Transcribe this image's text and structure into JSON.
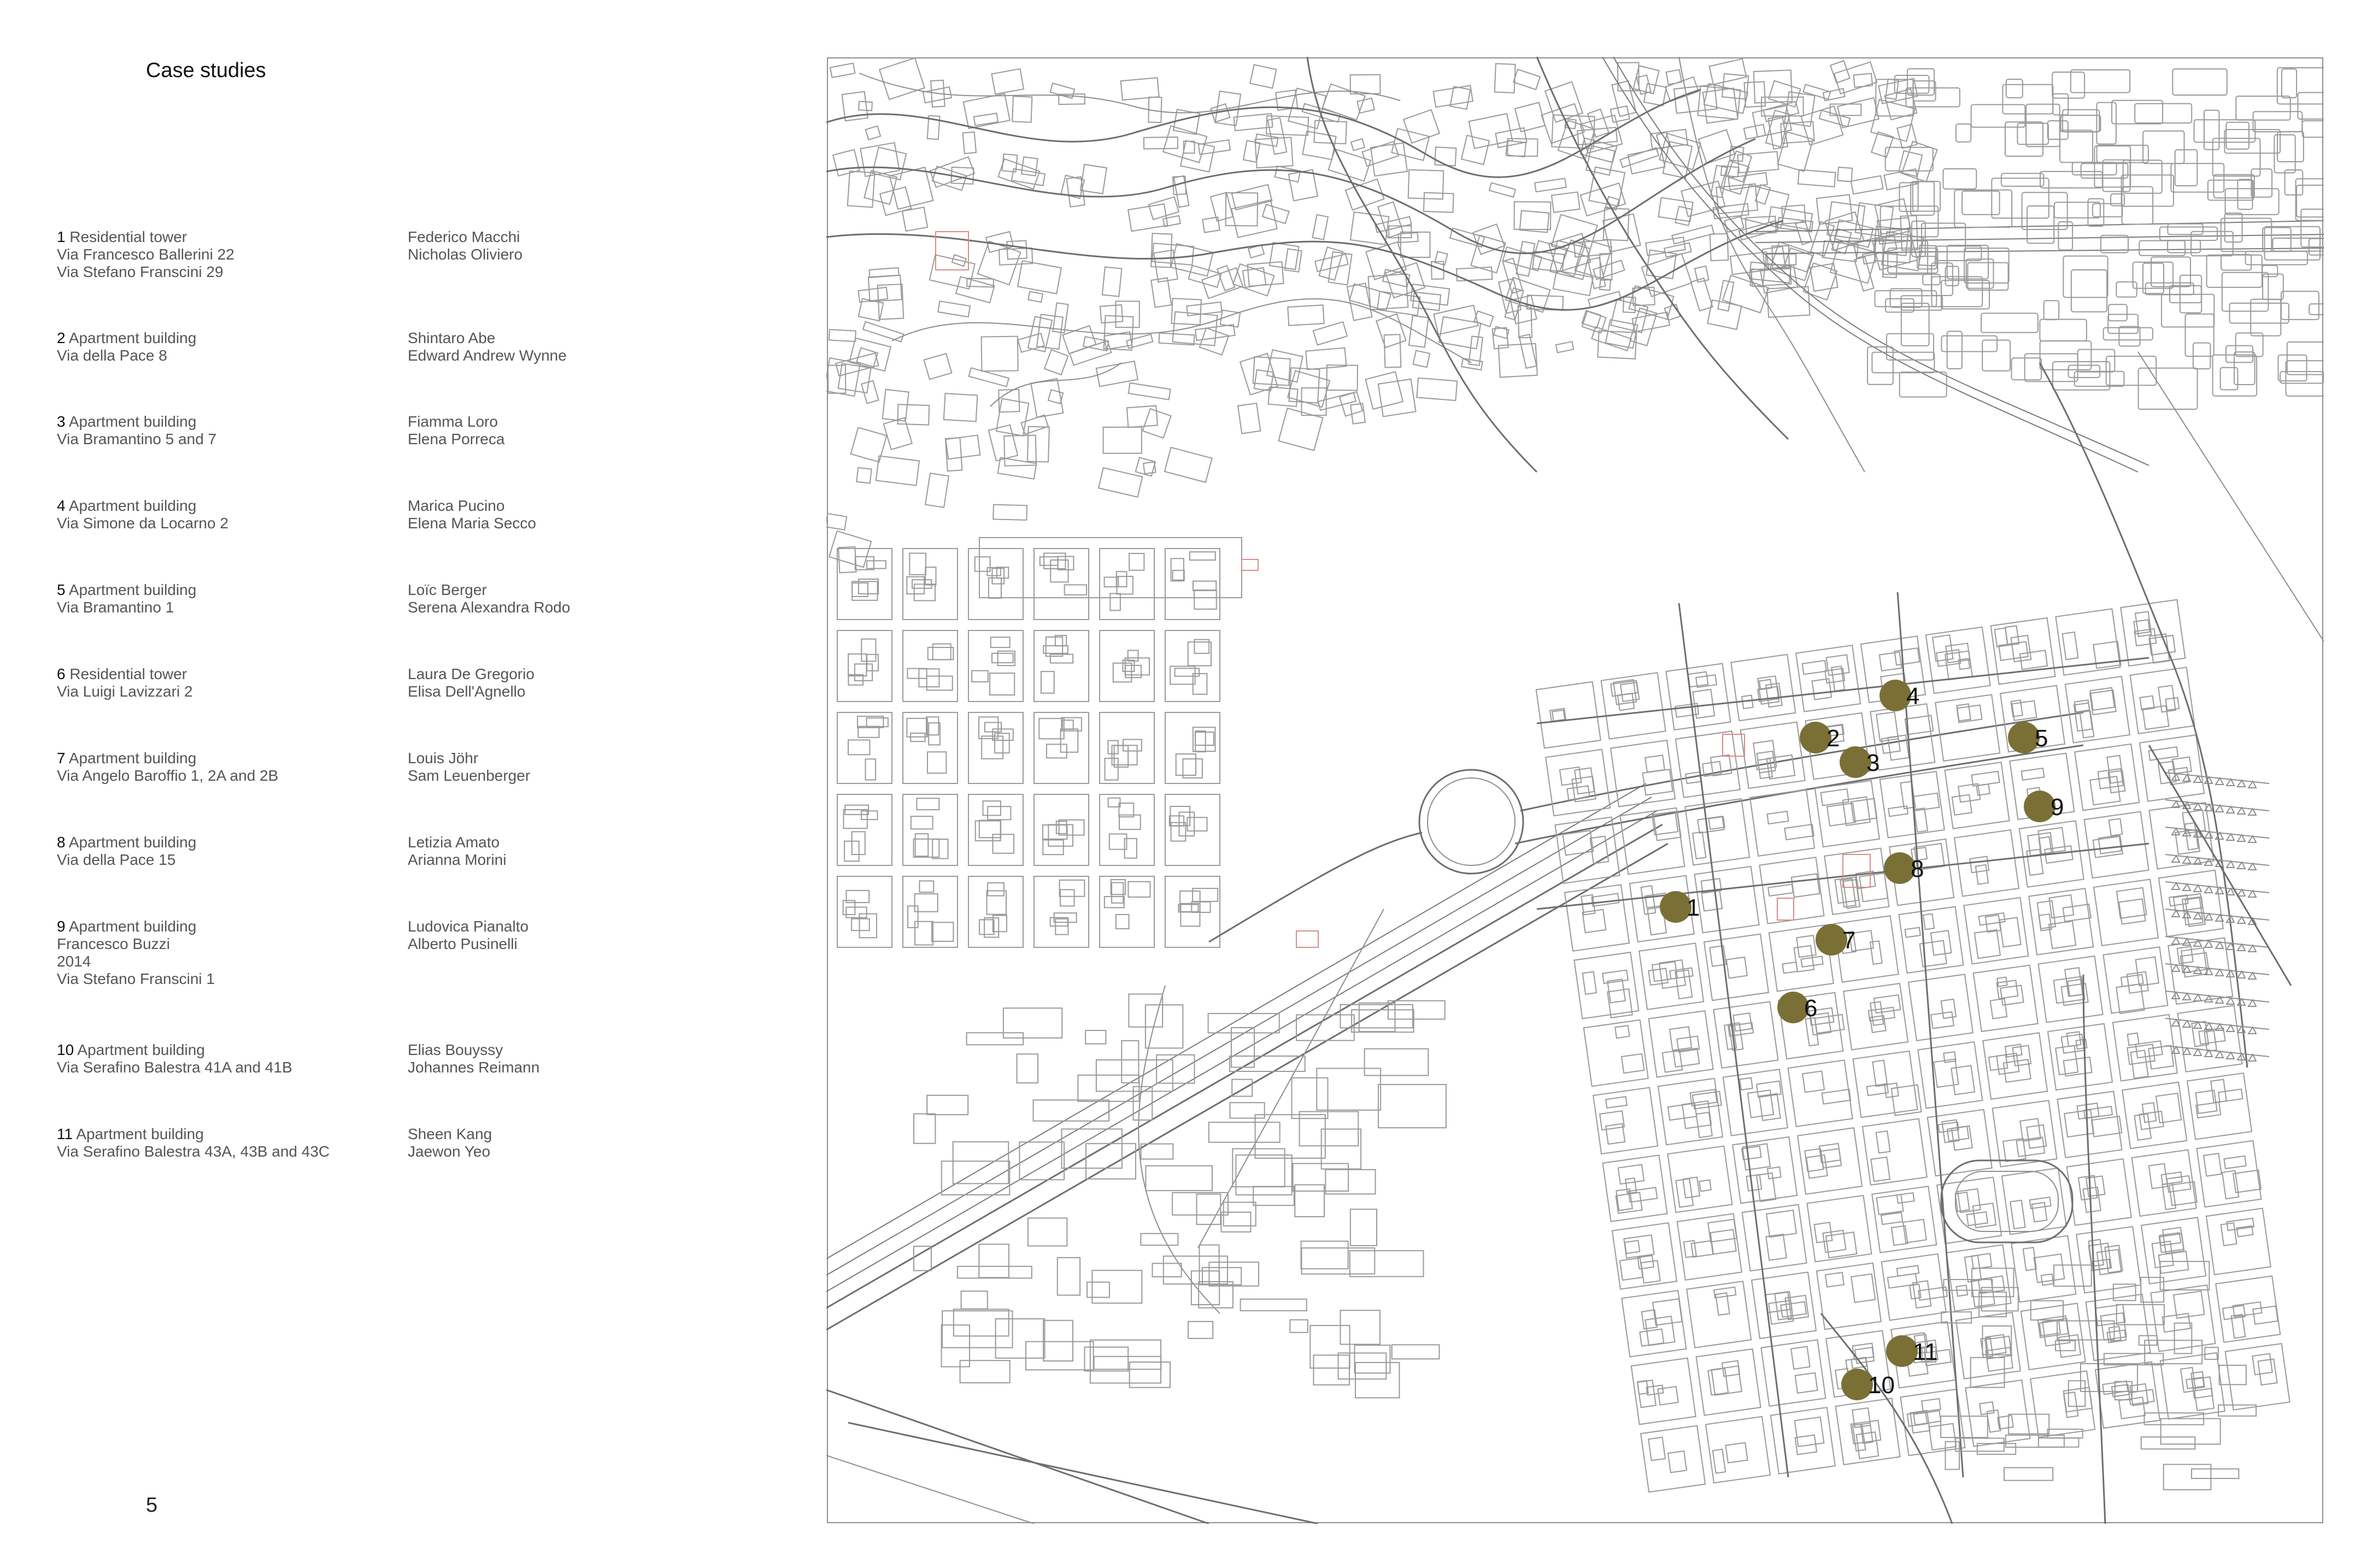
{
  "page": {
    "title": "Case studies",
    "page_number": "5"
  },
  "case_studies": [
    {
      "number": "1",
      "type": "Residential tower",
      "details": [
        "Via Francesco Ballerini 22",
        "Via Stefano Franscini 29"
      ],
      "authors": [
        "Federico Macchi",
        "Nicholas Oliviero"
      ]
    },
    {
      "number": "2",
      "type": "Apartment building",
      "details": [
        "Via della Pace 8"
      ],
      "authors": [
        "Shintaro Abe",
        "Edward Andrew Wynne"
      ]
    },
    {
      "number": "3",
      "type": "Apartment building",
      "details": [
        "Via Bramantino 5 and 7"
      ],
      "authors": [
        "Fiamma Loro",
        "Elena Porreca"
      ]
    },
    {
      "number": "4",
      "type": "Apartment building",
      "details": [
        "Via Simone da Locarno 2"
      ],
      "authors": [
        "Marica Pucino",
        "Elena Maria Secco"
      ]
    },
    {
      "number": "5",
      "type": "Apartment building",
      "details": [
        "Via Bramantino 1"
      ],
      "authors": [
        "Loïc Berger",
        "Serena Alexandra Rodo"
      ]
    },
    {
      "number": "6",
      "type": "Residential tower",
      "details": [
        "Via Luigi Lavizzari 2"
      ],
      "authors": [
        "Laura De Gregorio",
        "Elisa Dell'Agnello"
      ]
    },
    {
      "number": "7",
      "type": "Apartment building",
      "details": [
        "Via Angelo Baroffio 1, 2A and 2B"
      ],
      "authors": [
        "Louis Jöhr",
        "Sam Leuenberger"
      ]
    },
    {
      "number": "8",
      "type": "Apartment building",
      "details": [
        "Via della Pace 15"
      ],
      "authors": [
        "Letizia Amato",
        "Arianna Morini"
      ]
    },
    {
      "number": "9",
      "type": "Apartment building",
      "details": [
        "Francesco Buzzi",
        "2014",
        "Via Stefano Franscini 1"
      ],
      "authors": [
        "Ludovica Pianalto",
        "Alberto Pusinelli"
      ]
    },
    {
      "number": "10",
      "type": "Apartment building",
      "details": [
        "Via Serafino Balestra 41A and 41B"
      ],
      "authors": [
        "Elias Bouyssy",
        "Johannes Reimann"
      ]
    },
    {
      "number": "11",
      "type": "Apartment building",
      "details": [
        "Via Serafino Balestra 43A, 43B and 43C"
      ],
      "authors": [
        "Sheen Kang",
        "Jaewon Yeo"
      ]
    }
  ],
  "map": {
    "marker_color": "#7a7036",
    "markers": [
      {
        "label": "1"
      },
      {
        "label": "2"
      },
      {
        "label": "3"
      },
      {
        "label": "4"
      },
      {
        "label": "5"
      },
      {
        "label": "6"
      },
      {
        "label": "7"
      },
      {
        "label": "8"
      },
      {
        "label": "9"
      },
      {
        "label": "10"
      },
      {
        "label": "11"
      }
    ]
  }
}
